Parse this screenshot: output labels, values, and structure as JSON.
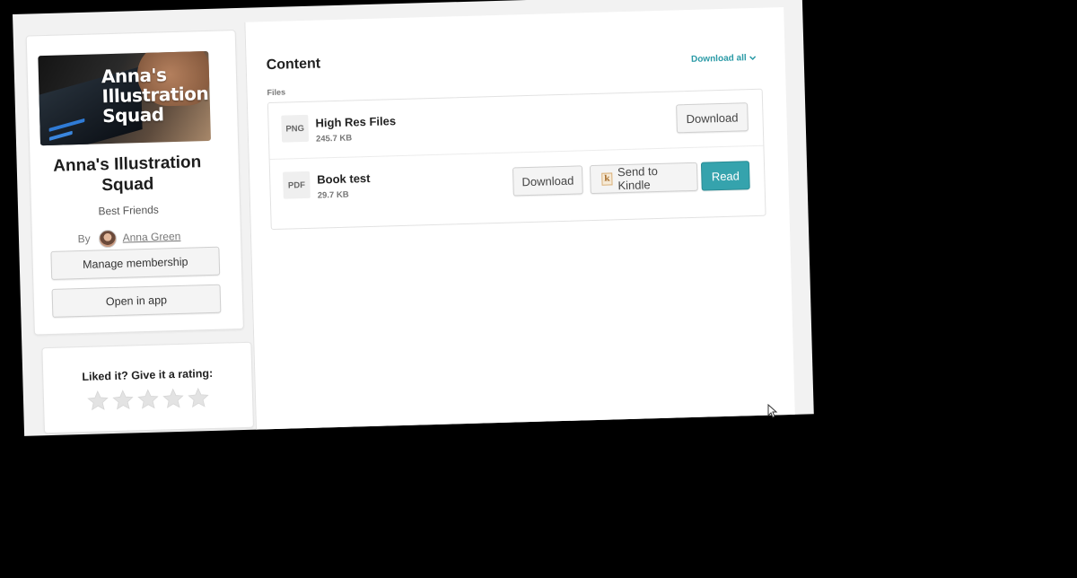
{
  "product": {
    "cover_text": "Anna's Illustration Squad",
    "title": "Anna's Illustration Squad",
    "subtitle": "Best Friends",
    "by_label": "By",
    "author": "Anna Green",
    "manage_membership_label": "Manage membership",
    "open_in_app_label": "Open in app"
  },
  "rating": {
    "prompt": "Liked it? Give it a rating:",
    "max_stars": 5,
    "value": 0
  },
  "content": {
    "title": "Content",
    "download_all_label": "Download all",
    "files_label": "Files",
    "files": [
      {
        "type": "PNG",
        "name": "High Res Files",
        "size": "245.7 KB",
        "download_label": "Download"
      },
      {
        "type": "PDF",
        "name": "Book test",
        "size": "29.7 KB",
        "download_label": "Download",
        "kindle_label": "Send to Kindle",
        "kindle_icon_letter": "k",
        "read_label": "Read"
      }
    ]
  },
  "colors": {
    "accent": "#35a3ad",
    "link_accent": "#2a9aa6",
    "background": "#f2f2f2",
    "star_empty": "#e3e3e3"
  }
}
